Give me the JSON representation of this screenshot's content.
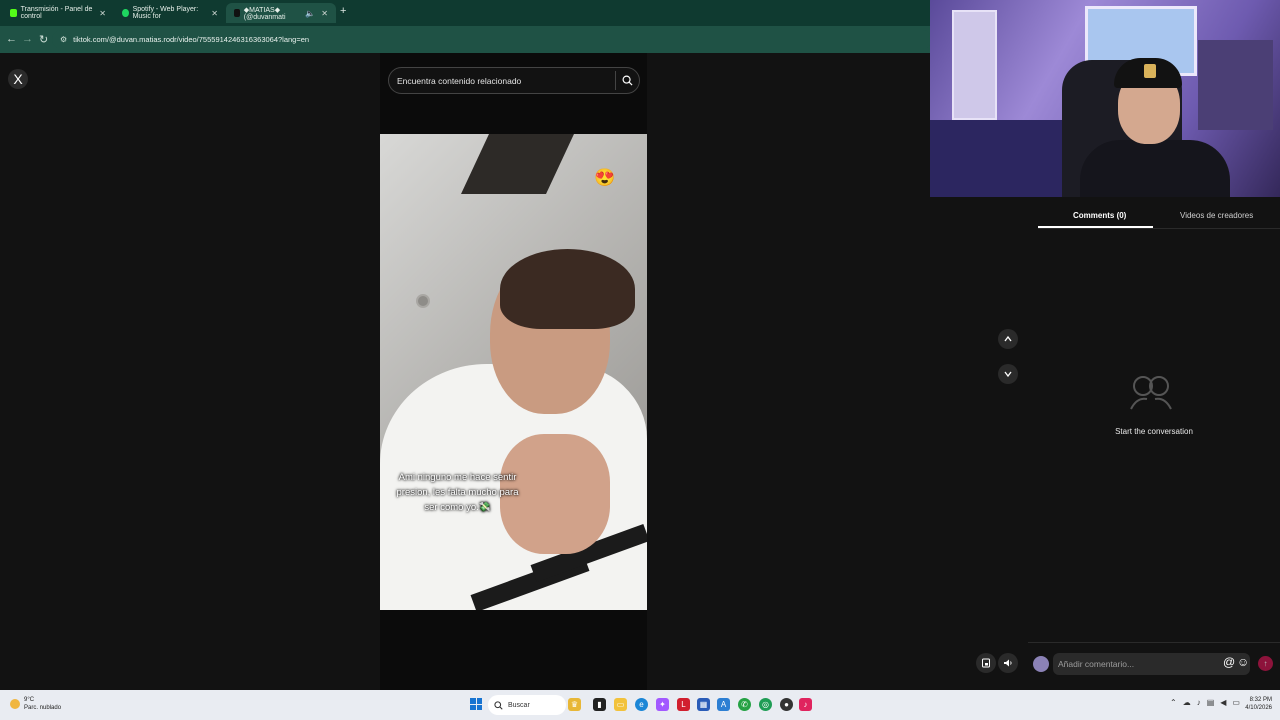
{
  "browser": {
    "tabs": [
      {
        "title": "Transmisión - Panel de control",
        "favicon_color": "#53fc18",
        "active": false
      },
      {
        "title": "Spotify - Web Player: Music for",
        "favicon_color": "#1ed760",
        "active": false
      },
      {
        "title": "◆MATIAS◆ (@duvanmati",
        "favicon_color": "#111111",
        "active": true
      }
    ],
    "new_tab_label": "+",
    "url": "tiktok.com/@duvan.matias.rodr/video/7555914246316363064?lang=en"
  },
  "tiktok": {
    "close_label": "X",
    "search": {
      "placeholder": "Encuentra contenido relacionado"
    },
    "video": {
      "caption": "Ami ninguno me hace sentir presion, les falta mucho para ser como yo.💸",
      "sticker": "😍"
    },
    "panel": {
      "tabs": [
        "Comments (0)",
        "Videos de creadores"
      ],
      "active_tab": "Comments (0)",
      "empty_state": "Start the conversation"
    },
    "comment": {
      "placeholder": "Añadir comentario...",
      "at_label": "@",
      "emoji_label": "☺",
      "send_label": "↑"
    },
    "accent_color": "#fe2c55"
  },
  "taskbar": {
    "weather": {
      "temp": "9°C",
      "condition": "Parc. nublado"
    },
    "search_label": "Buscar",
    "clock": {
      "time": "8:32 PM",
      "date": "4/10/2026"
    },
    "apps": [
      "crown-app-icon",
      "file-explorer-icon",
      "folder-icon",
      "edge-icon",
      "figma-icon",
      "l-app-icon",
      "store-icon",
      "azure-icon",
      "whatsapp-icon",
      "chrome-icon",
      "obs-icon",
      "tiktok-icon"
    ]
  }
}
